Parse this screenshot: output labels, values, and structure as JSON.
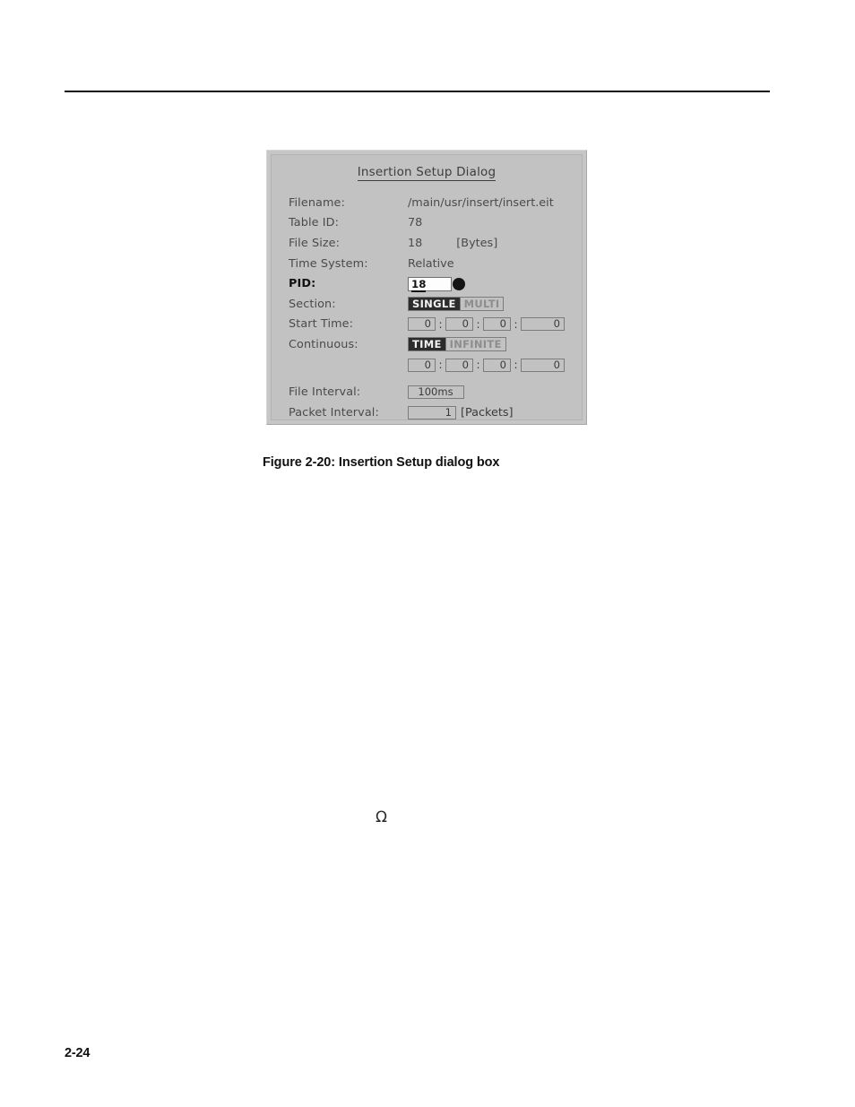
{
  "page": {
    "number": "2-24",
    "omega_symbol": "Ω"
  },
  "figure": {
    "caption": "Figure 2-20: Insertion Setup dialog box"
  },
  "dialog": {
    "title": "Insertion Setup Dialog",
    "rows": {
      "filename": {
        "label": "Filename:",
        "value": "/main/usr/insert/insert.eit"
      },
      "table_id": {
        "label": "Table ID:",
        "value": "78"
      },
      "file_size": {
        "label": "File Size:",
        "value": "18",
        "unit": "[Bytes]"
      },
      "time_system": {
        "label": "Time System:",
        "value": "Relative"
      },
      "pid": {
        "label": "PID:",
        "value": "18"
      },
      "section": {
        "label": "Section:",
        "options": [
          "SINGLE",
          "MULTI"
        ],
        "selected": "SINGLE"
      },
      "start_time": {
        "label": "Start Time:",
        "values": [
          "0",
          "0",
          "0",
          "0"
        ],
        "separator": ":"
      },
      "continuous": {
        "label": "Continuous:",
        "options": [
          "TIME",
          "INFINITE"
        ],
        "selected": "TIME",
        "values": [
          "0",
          "0",
          "0",
          "0"
        ],
        "separator": ":"
      },
      "file_interval": {
        "label": "File Interval:",
        "value": "100ms"
      },
      "packet_interval": {
        "label": "Packet Interval:",
        "value": "1",
        "unit": "[Packets]"
      }
    }
  },
  "colors": {
    "dialog_background": "#c2c2c2",
    "dialog_frame": "#c6c6c6",
    "selected_toggle_background": "#2c2c2c",
    "selected_toggle_text": "#f2f2f2",
    "label_text": "#4a4a4a",
    "active_field_background": "#fdfdfd",
    "page_background": "#ffffff"
  }
}
